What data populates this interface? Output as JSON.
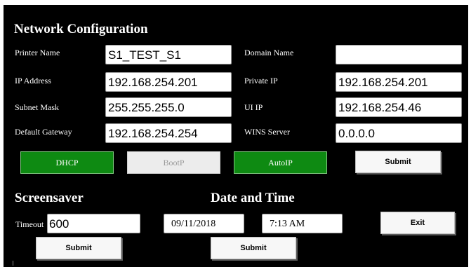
{
  "network": {
    "title": "Network Configuration",
    "printer_name": {
      "label": "Printer Name",
      "value": "S1_TEST_S1"
    },
    "ip_address": {
      "label": "IP Address",
      "value": "192.168.254.201"
    },
    "subnet_mask": {
      "label": "Subnet Mask",
      "value": "255.255.255.0"
    },
    "default_gateway": {
      "label": "Default Gateway",
      "value": "192.168.254.254"
    },
    "domain_name": {
      "label": "Domain Name",
      "value": ""
    },
    "private_ip": {
      "label": "Private IP",
      "value": "192.168.254.201"
    },
    "ui_ip": {
      "label": "UI IP",
      "value": "192.168.254.46"
    },
    "wins_server": {
      "label": "WINS Server",
      "value": "0.0.0.0"
    },
    "buttons": {
      "dhcp": "DHCP",
      "bootp": "BootP",
      "autoip": "AutoIP",
      "submit": "Submit"
    }
  },
  "screensaver": {
    "title": "Screensaver",
    "timeout_label": "Timeout",
    "timeout_value": "600",
    "submit": "Submit"
  },
  "datetime": {
    "title": "Date and Time",
    "date": "09/11/2018",
    "time": "7:13 AM",
    "submit": "Submit"
  },
  "exit_label": "Exit",
  "colors": {
    "panel": "#000000",
    "active_green": "#0e8a12",
    "disabled_gray": "#ececec"
  }
}
